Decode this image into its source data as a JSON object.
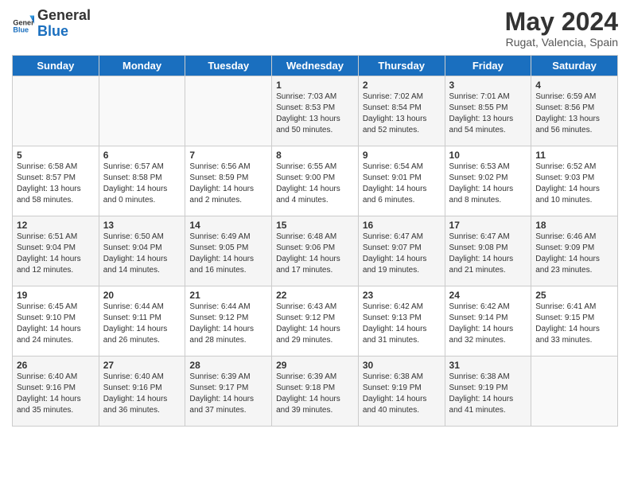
{
  "logo": {
    "general": "General",
    "blue": "Blue"
  },
  "header": {
    "month_year": "May 2024",
    "location": "Rugat, Valencia, Spain"
  },
  "weekdays": [
    "Sunday",
    "Monday",
    "Tuesday",
    "Wednesday",
    "Thursday",
    "Friday",
    "Saturday"
  ],
  "weeks": [
    [
      {
        "day": "",
        "info": ""
      },
      {
        "day": "",
        "info": ""
      },
      {
        "day": "",
        "info": ""
      },
      {
        "day": "1",
        "info": "Sunrise: 7:03 AM\nSunset: 8:53 PM\nDaylight: 13 hours\nand 50 minutes."
      },
      {
        "day": "2",
        "info": "Sunrise: 7:02 AM\nSunset: 8:54 PM\nDaylight: 13 hours\nand 52 minutes."
      },
      {
        "day": "3",
        "info": "Sunrise: 7:01 AM\nSunset: 8:55 PM\nDaylight: 13 hours\nand 54 minutes."
      },
      {
        "day": "4",
        "info": "Sunrise: 6:59 AM\nSunset: 8:56 PM\nDaylight: 13 hours\nand 56 minutes."
      }
    ],
    [
      {
        "day": "5",
        "info": "Sunrise: 6:58 AM\nSunset: 8:57 PM\nDaylight: 13 hours\nand 58 minutes."
      },
      {
        "day": "6",
        "info": "Sunrise: 6:57 AM\nSunset: 8:58 PM\nDaylight: 14 hours\nand 0 minutes."
      },
      {
        "day": "7",
        "info": "Sunrise: 6:56 AM\nSunset: 8:59 PM\nDaylight: 14 hours\nand 2 minutes."
      },
      {
        "day": "8",
        "info": "Sunrise: 6:55 AM\nSunset: 9:00 PM\nDaylight: 14 hours\nand 4 minutes."
      },
      {
        "day": "9",
        "info": "Sunrise: 6:54 AM\nSunset: 9:01 PM\nDaylight: 14 hours\nand 6 minutes."
      },
      {
        "day": "10",
        "info": "Sunrise: 6:53 AM\nSunset: 9:02 PM\nDaylight: 14 hours\nand 8 minutes."
      },
      {
        "day": "11",
        "info": "Sunrise: 6:52 AM\nSunset: 9:03 PM\nDaylight: 14 hours\nand 10 minutes."
      }
    ],
    [
      {
        "day": "12",
        "info": "Sunrise: 6:51 AM\nSunset: 9:04 PM\nDaylight: 14 hours\nand 12 minutes."
      },
      {
        "day": "13",
        "info": "Sunrise: 6:50 AM\nSunset: 9:04 PM\nDaylight: 14 hours\nand 14 minutes."
      },
      {
        "day": "14",
        "info": "Sunrise: 6:49 AM\nSunset: 9:05 PM\nDaylight: 14 hours\nand 16 minutes."
      },
      {
        "day": "15",
        "info": "Sunrise: 6:48 AM\nSunset: 9:06 PM\nDaylight: 14 hours\nand 17 minutes."
      },
      {
        "day": "16",
        "info": "Sunrise: 6:47 AM\nSunset: 9:07 PM\nDaylight: 14 hours\nand 19 minutes."
      },
      {
        "day": "17",
        "info": "Sunrise: 6:47 AM\nSunset: 9:08 PM\nDaylight: 14 hours\nand 21 minutes."
      },
      {
        "day": "18",
        "info": "Sunrise: 6:46 AM\nSunset: 9:09 PM\nDaylight: 14 hours\nand 23 minutes."
      }
    ],
    [
      {
        "day": "19",
        "info": "Sunrise: 6:45 AM\nSunset: 9:10 PM\nDaylight: 14 hours\nand 24 minutes."
      },
      {
        "day": "20",
        "info": "Sunrise: 6:44 AM\nSunset: 9:11 PM\nDaylight: 14 hours\nand 26 minutes."
      },
      {
        "day": "21",
        "info": "Sunrise: 6:44 AM\nSunset: 9:12 PM\nDaylight: 14 hours\nand 28 minutes."
      },
      {
        "day": "22",
        "info": "Sunrise: 6:43 AM\nSunset: 9:12 PM\nDaylight: 14 hours\nand 29 minutes."
      },
      {
        "day": "23",
        "info": "Sunrise: 6:42 AM\nSunset: 9:13 PM\nDaylight: 14 hours\nand 31 minutes."
      },
      {
        "day": "24",
        "info": "Sunrise: 6:42 AM\nSunset: 9:14 PM\nDaylight: 14 hours\nand 32 minutes."
      },
      {
        "day": "25",
        "info": "Sunrise: 6:41 AM\nSunset: 9:15 PM\nDaylight: 14 hours\nand 33 minutes."
      }
    ],
    [
      {
        "day": "26",
        "info": "Sunrise: 6:40 AM\nSunset: 9:16 PM\nDaylight: 14 hours\nand 35 minutes."
      },
      {
        "day": "27",
        "info": "Sunrise: 6:40 AM\nSunset: 9:16 PM\nDaylight: 14 hours\nand 36 minutes."
      },
      {
        "day": "28",
        "info": "Sunrise: 6:39 AM\nSunset: 9:17 PM\nDaylight: 14 hours\nand 37 minutes."
      },
      {
        "day": "29",
        "info": "Sunrise: 6:39 AM\nSunset: 9:18 PM\nDaylight: 14 hours\nand 39 minutes."
      },
      {
        "day": "30",
        "info": "Sunrise: 6:38 AM\nSunset: 9:19 PM\nDaylight: 14 hours\nand 40 minutes."
      },
      {
        "day": "31",
        "info": "Sunrise: 6:38 AM\nSunset: 9:19 PM\nDaylight: 14 hours\nand 41 minutes."
      },
      {
        "day": "",
        "info": ""
      }
    ]
  ]
}
